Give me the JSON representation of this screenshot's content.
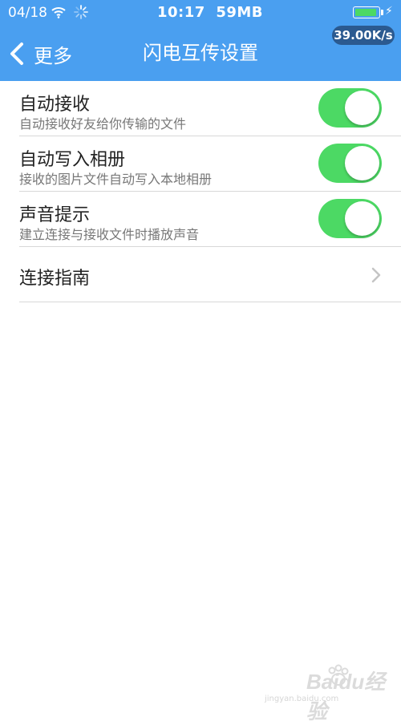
{
  "status_bar": {
    "date": "04/18",
    "time": "10:17  59MB",
    "battery_level": 0.95,
    "net_speed": "39.00K/s"
  },
  "nav": {
    "back_label": "更多",
    "title": "闪电互传设置"
  },
  "settings": [
    {
      "title": "自动接收",
      "subtitle": "自动接收好友给你传输的文件",
      "enabled": true
    },
    {
      "title": "自动写入相册",
      "subtitle": "接收的图片文件自动写入本地相册",
      "enabled": true
    },
    {
      "title": "声音提示",
      "subtitle": "建立连接与接收文件时播放声音",
      "enabled": true
    }
  ],
  "guide": {
    "title": "连接指南"
  },
  "watermark": {
    "logo_text": "Baidu经验",
    "sub_text": "jingyan.baidu.com"
  },
  "colors": {
    "header": "#4a9ff0",
    "switch_on": "#4cd964",
    "speed_badge": "#2b5a90"
  }
}
